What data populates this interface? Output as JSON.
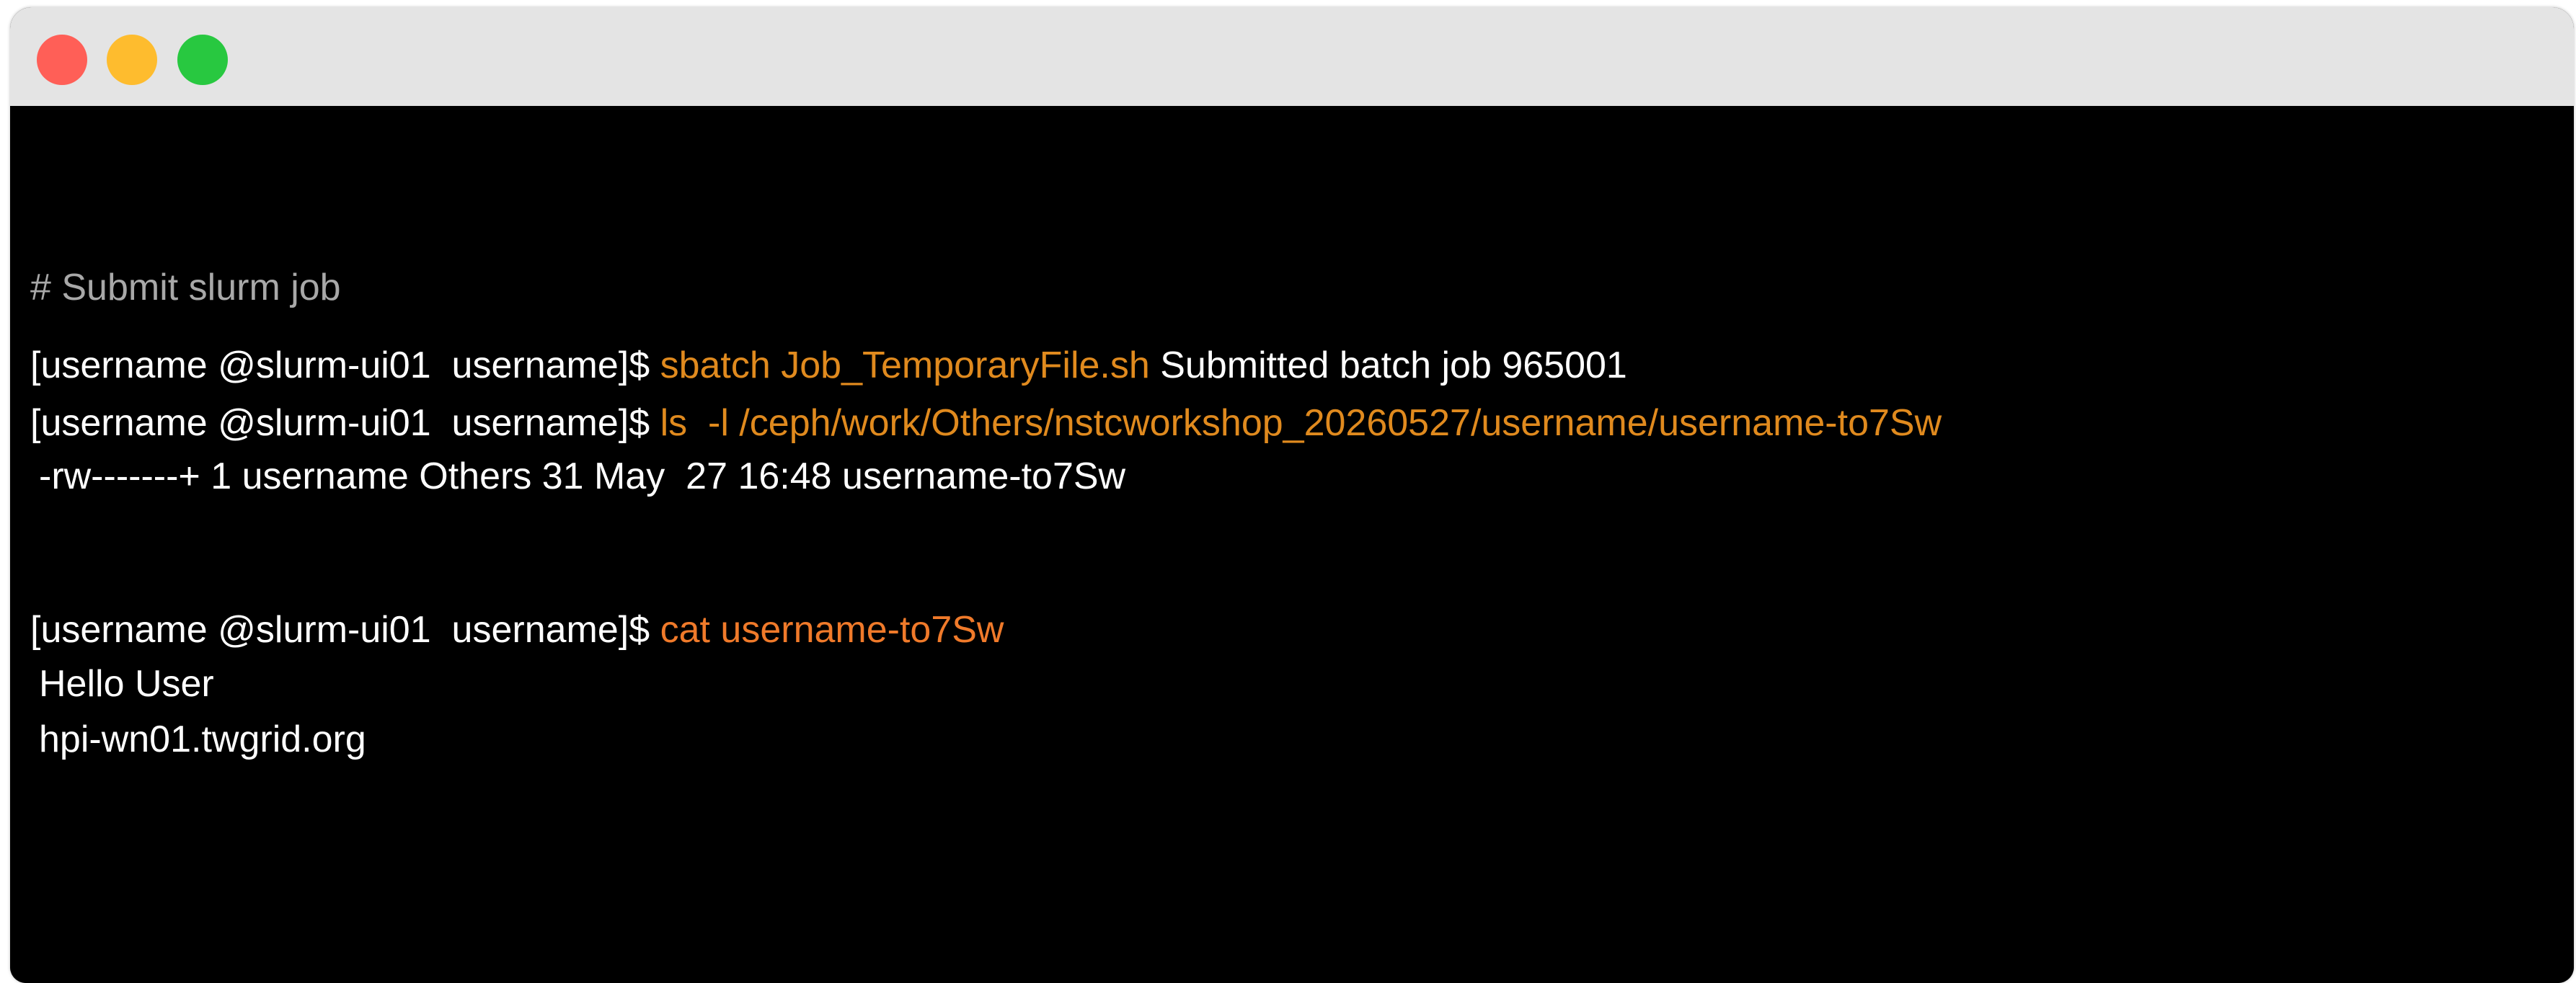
{
  "window": {
    "controls": [
      "close",
      "minimize",
      "maximize"
    ],
    "colors": {
      "close": "#ff5f57",
      "minimize": "#febc2e",
      "maximize": "#28c840",
      "titlebar": "#e4e4e4",
      "background": "#000000",
      "text": "#ffffff",
      "comment": "#a8a8a8",
      "command": "#e08a1e"
    }
  },
  "terminal": {
    "comment": "# Submit slurm job",
    "lines": [
      {
        "prompt": "[username @slurm-ui01  username]$ ",
        "command": "sbatch Job_TemporaryFile.sh",
        "output": " Submitted batch job 965001"
      },
      {
        "prompt": "[username @slurm-ui01  username]$ ",
        "command": "ls  -l /ceph/work/Others/nstcworkshop_20260527/username/username-to7Sw",
        "output": ""
      },
      {
        "prompt": "",
        "command": "",
        "output": "-rw-------+ 1 username Others 31 May  27 16:48 username-to7Sw"
      },
      {
        "prompt": "[username @slurm-ui01  username]$ ",
        "command": "cat username-to7Sw",
        "output": ""
      },
      {
        "prompt": "",
        "command": "",
        "output": "Hello User"
      },
      {
        "prompt": "",
        "command": "",
        "output": "hpi-wn01.twgrid.org"
      }
    ]
  }
}
